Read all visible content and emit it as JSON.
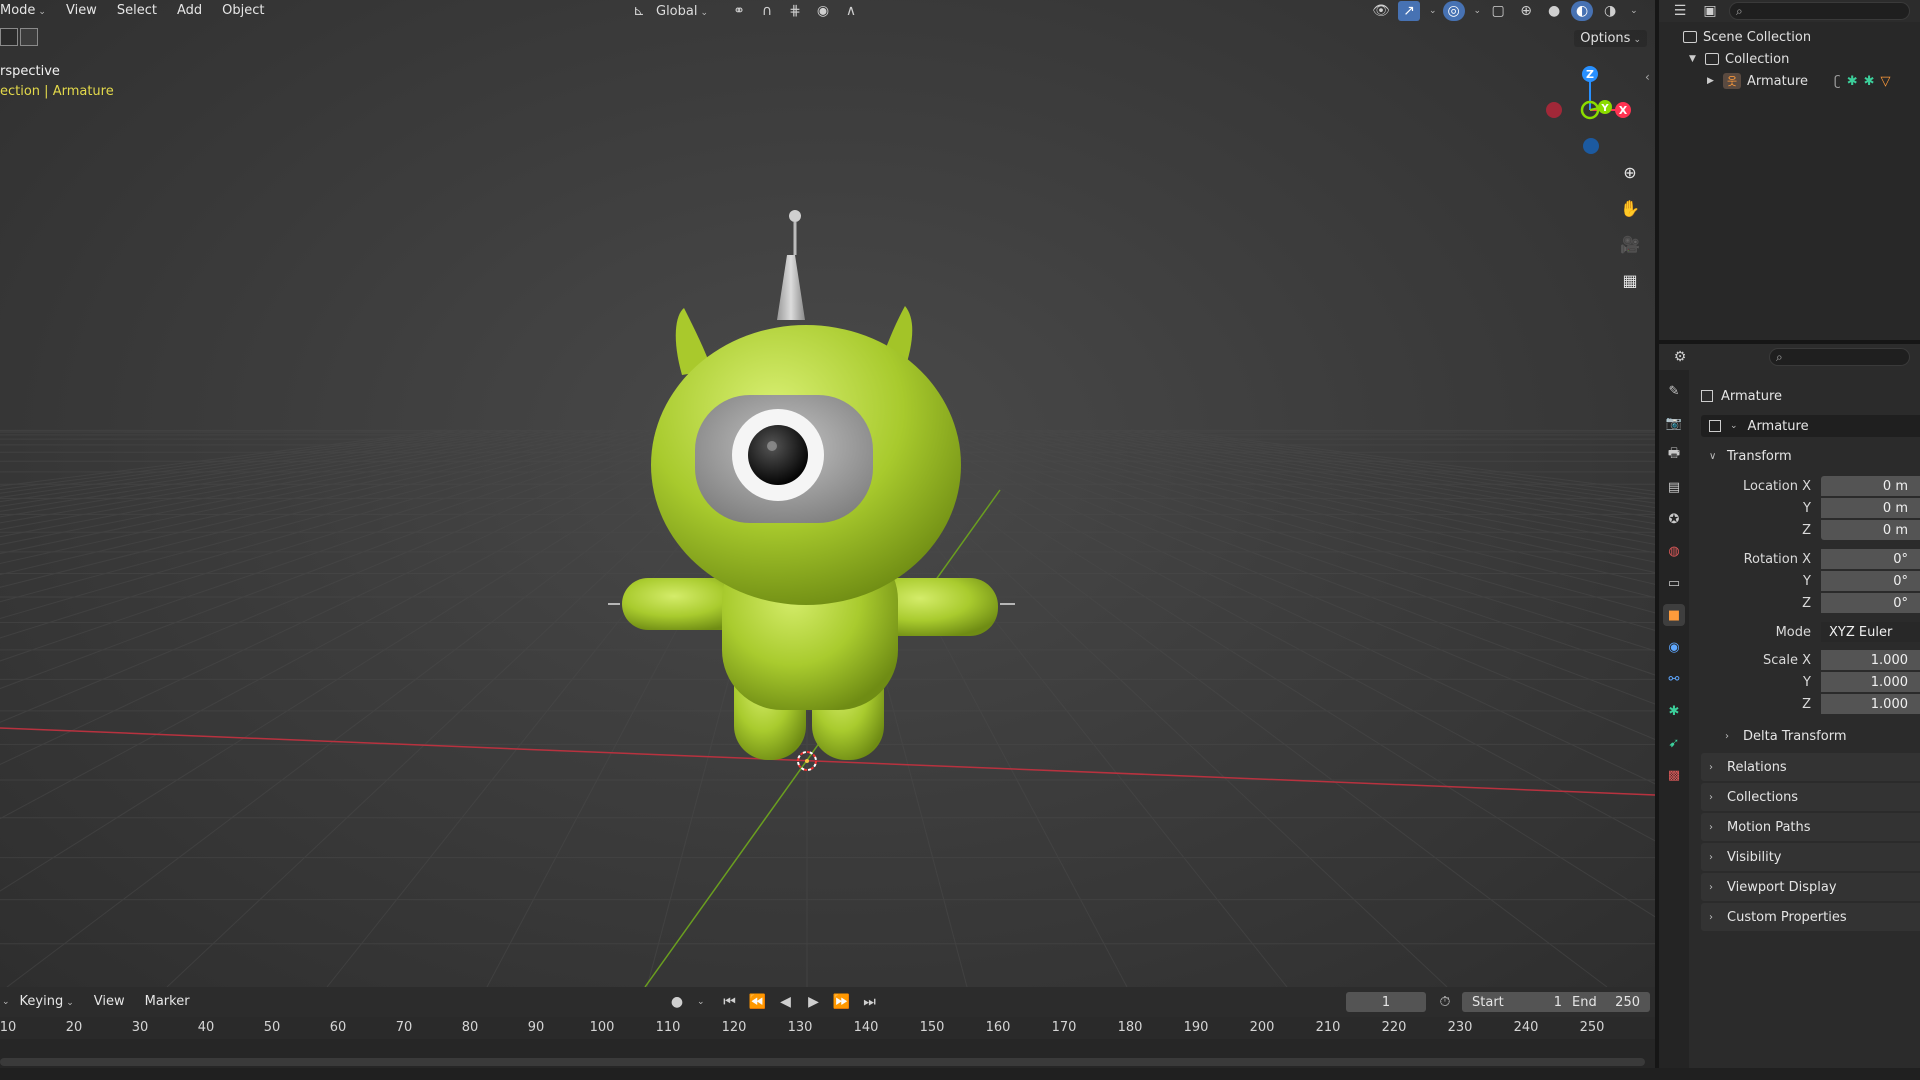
{
  "viewport": {
    "header": {
      "mode_label": "Mode",
      "menus": [
        "View",
        "Select",
        "Add",
        "Object"
      ],
      "transform_orientation": "Global"
    },
    "options_label": "Options",
    "info_line1": "rspective",
    "info_line2": "ection | Armature"
  },
  "gizmo": {
    "z": "Z",
    "y": "Y",
    "x": "X"
  },
  "outliner": {
    "scene_collection": "Scene Collection",
    "collection": "Collection",
    "armature": "Armature"
  },
  "properties": {
    "object_name": "Armature",
    "object_field": "Armature",
    "transform": {
      "title": "Transform",
      "location": {
        "label_x": "Location X",
        "label_y": "Y",
        "label_z": "Z",
        "x": "0 m",
        "y": "0 m",
        "z": "0 m"
      },
      "rotation": {
        "label_x": "Rotation X",
        "label_y": "Y",
        "label_z": "Z",
        "x": "0°",
        "y": "0°",
        "z": "0°"
      },
      "mode_label": "Mode",
      "mode_value": "XYZ Euler",
      "scale": {
        "label_x": "Scale X",
        "label_y": "Y",
        "label_z": "Z",
        "x": "1.000",
        "y": "1.000",
        "z": "1.000"
      },
      "delta": "Delta Transform"
    },
    "panels": [
      "Relations",
      "Collections",
      "Motion Paths",
      "Visibility",
      "Viewport Display",
      "Custom Properties"
    ]
  },
  "timeline": {
    "keying": "Keying",
    "view": "View",
    "marker": "Marker",
    "current_frame": "1",
    "start_label": "Start",
    "start_value": "1",
    "end_label": "End",
    "end_value": "250",
    "ticks": [
      "10",
      "20",
      "30",
      "40",
      "50",
      "60",
      "70",
      "80",
      "90",
      "100",
      "110",
      "120",
      "130",
      "140",
      "150",
      "160",
      "170",
      "180",
      "190",
      "200",
      "210",
      "220",
      "230",
      "240",
      "250"
    ]
  },
  "colors": {
    "accent": "#4772b3",
    "x_axis": "#ff3352",
    "y_axis": "#8bdc00",
    "z_axis": "#2890ff",
    "selected_text": "#e3d94b",
    "object_tab": "#ff9b3b"
  }
}
